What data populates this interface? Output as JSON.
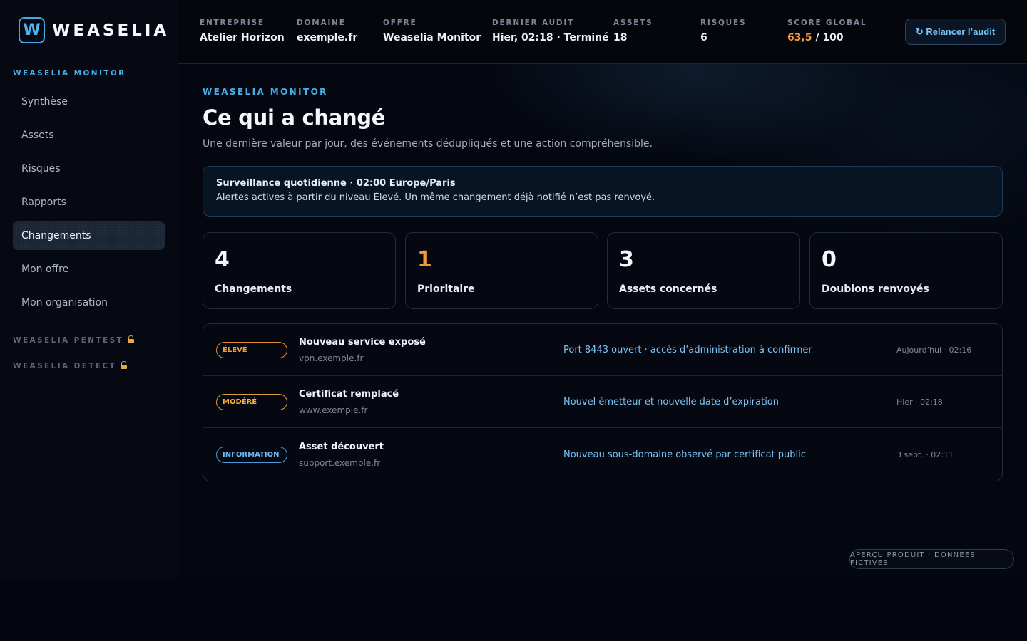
{
  "brand": {
    "logo_letter": "W",
    "name": "WEASELIA",
    "accent": "#3fa9e8"
  },
  "sidebar": {
    "active_section": "WEASELIA MONITOR",
    "items": [
      {
        "label": "Synthèse"
      },
      {
        "label": "Assets"
      },
      {
        "label": "Risques"
      },
      {
        "label": "Rapports"
      },
      {
        "label": "Changements",
        "selected": true
      },
      {
        "label": "Mon offre"
      },
      {
        "label": "Mon organisation"
      }
    ],
    "locked_sections": [
      {
        "label": "WEASELIA PENTEST",
        "icon": "lock-icon"
      },
      {
        "label": "WEASELIA DETECT",
        "icon": "lock-icon"
      }
    ]
  },
  "topbar": {
    "company": {
      "label": "ENTREPRISE",
      "value": "Atelier Horizon"
    },
    "domain": {
      "label": "DOMAINE",
      "value": "exemple.fr"
    },
    "offer": {
      "label": "OFFRE",
      "value": "Weaselia Monitor"
    },
    "last_audit": {
      "label": "DERNIER AUDIT",
      "value": "Hier, 02:18 · Terminé"
    },
    "assets": {
      "label": "ASSETS",
      "value": "18"
    },
    "risks": {
      "label": "RISQUES",
      "value": "6"
    },
    "score": {
      "label": "SCORE GLOBAL",
      "value": "63,5",
      "max": " / 100",
      "color": "#f19a3a"
    },
    "relaunch_label": "↻ Relancer l’audit"
  },
  "main": {
    "eyebrow": "WEASELIA MONITOR",
    "title": "Ce qui a changé",
    "subtitle": "Une dernière valeur par jour, des événements dédupliqués et une action compréhensible.",
    "info": {
      "title": "Surveillance quotidienne · 02:00 Europe/Paris",
      "text": "Alertes actives à partir du niveau Élevé. Un même changement déjà notifié n’est pas renvoyé."
    },
    "kpis": [
      {
        "value": "4",
        "label": "Changements"
      },
      {
        "value": "1",
        "label": "Prioritaire",
        "color": "#f19a3a"
      },
      {
        "value": "3",
        "label": "Assets concernés"
      },
      {
        "value": "0",
        "label": "Doublons renvoyés"
      }
    ],
    "events": [
      {
        "severity": "ÉLEVÉ",
        "title": "Nouveau service exposé",
        "host": "vpn.exemple.fr",
        "description": "Port 8443 ouvert · accès d’administration à confirmer",
        "time": "Aujourd’hui · 02:16"
      },
      {
        "severity": "MODÉRÉ",
        "title": "Certificat remplacé",
        "host": "www.exemple.fr",
        "description": "Nouvel émetteur et nouvelle date d’expiration",
        "time": "Hier · 02:18"
      },
      {
        "severity": "INFORMATION",
        "title": "Asset découvert",
        "host": "support.exemple.fr",
        "description": "Nouveau sous-domaine observé par certificat public",
        "time": "3 sept. · 02:11"
      }
    ]
  },
  "footer_badge": "APERÇU PRODUIT · DONNÉES FICTIVES"
}
